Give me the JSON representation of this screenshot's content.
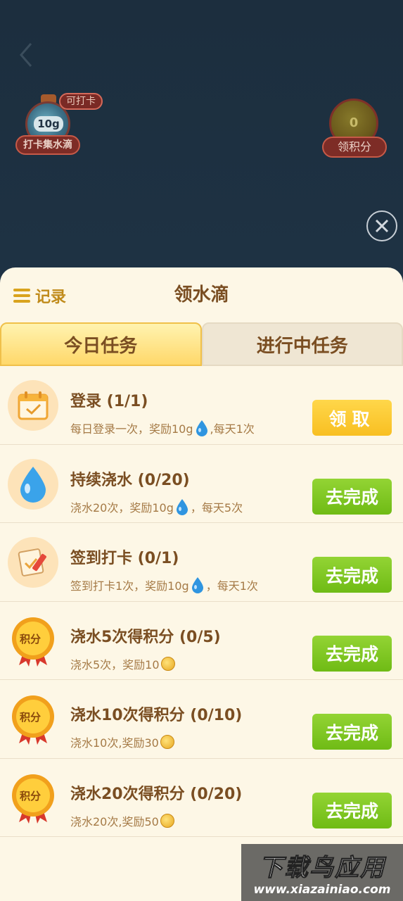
{
  "header": {
    "checkin_badge": "可打卡",
    "bottle_amount": "10g",
    "checkin_caption": "打卡集水滴",
    "points_value": "0",
    "points_caption": "领积分"
  },
  "sheet": {
    "record_label": "记录",
    "title": "领水滴",
    "tabs": [
      {
        "label": "今日任务",
        "active": true
      },
      {
        "label": "进行中任务",
        "active": false
      }
    ],
    "tasks": [
      {
        "icon": "calendar-icon",
        "title": "登录 (1/1)",
        "desc_a": "每日登录一次，奖励10g",
        "desc_b": ",每天1次",
        "reward": "water-drop-icon",
        "button": "领取",
        "button_type": "claim"
      },
      {
        "icon": "water-drop-icon",
        "title": "持续浇水 (0/20)",
        "desc_a": "浇水20次，奖励10g",
        "desc_b": "，每天5次",
        "reward": "water-drop-icon",
        "button": "去完成",
        "button_type": "go"
      },
      {
        "icon": "sign-in-note-icon",
        "title": "签到打卡 (0/1)",
        "desc_a": "签到打卡1次，奖励10g",
        "desc_b": "，每天1次",
        "reward": "water-drop-icon",
        "button": "去完成",
        "button_type": "go"
      },
      {
        "icon": "points-medal-icon",
        "medal_text": "积分",
        "title": "浇水5次得积分 (0/5)",
        "desc_a": "浇水5次，奖励10",
        "desc_b": "",
        "reward": "points-coin-icon",
        "button": "去完成",
        "button_type": "go"
      },
      {
        "icon": "points-medal-icon",
        "medal_text": "积分",
        "title": "浇水10次得积分 (0/10)",
        "desc_a": "浇水10次,奖励30",
        "desc_b": "",
        "reward": "points-coin-icon",
        "button": "去完成",
        "button_type": "go"
      },
      {
        "icon": "points-medal-icon",
        "medal_text": "积分",
        "title": "浇水20次得积分 (0/20)",
        "desc_a": "浇水20次,奖励50",
        "desc_b": "",
        "reward": "points-coin-icon",
        "button": "去完成",
        "button_type": "go"
      }
    ]
  },
  "watermark": {
    "big": "下载鸟应用",
    "small": "www.xiazainiao.com"
  },
  "colors": {
    "go_button": "#6fbb15",
    "claim_button": "#f8bf22",
    "title_brown": "#7a4e22",
    "sheet_bg": "#fdf7e6"
  }
}
